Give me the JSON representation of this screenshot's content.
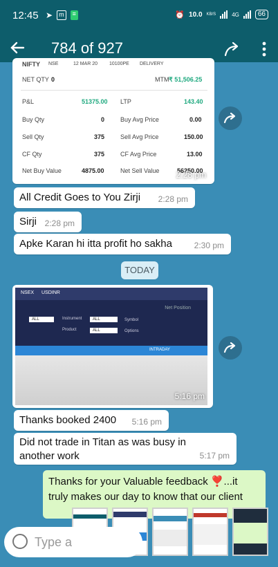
{
  "status": {
    "time": "12:45",
    "speed": "10.0",
    "speed_unit": "KB/S",
    "network": "4G",
    "battery": "66"
  },
  "app_bar": {
    "title": "784 of 927"
  },
  "trade_card": {
    "symbol": "NIFTY",
    "exchange": "NSE",
    "expiry": "12 MAR 20",
    "strike": "10100PE",
    "type": "DELIVERY",
    "net_qty_label": "NET QTY",
    "net_qty": "0",
    "mtm_label": "MTM",
    "mtm": "₹ 51,506.25",
    "pl_label": "P&L",
    "pl": "51375.00",
    "ltp_label": "LTP",
    "ltp": "143.40",
    "buy_qty_label": "Buy Qty",
    "buy_qty": "0",
    "buy_avg_label": "Buy Avg Price",
    "buy_avg": "0.00",
    "sell_qty_label": "Sell Qty",
    "sell_qty": "375",
    "sell_avg_label": "Sell Avg Price",
    "sell_avg": "150.00",
    "cf_qty_label": "CF Qty",
    "cf_qty": "375",
    "cf_avg_label": "CF Avg Price",
    "cf_avg": "13.00",
    "net_buy_label": "Net Buy Value",
    "net_buy": "4875.00",
    "net_sell_label": "Net Sell Value",
    "net_sell": "56250.00",
    "time": "2:28 pm"
  },
  "messages": [
    {
      "text": "All Credit Goes to You Zirji",
      "time": "2:28 pm"
    },
    {
      "text": "Sirji",
      "time": "2:28 pm"
    },
    {
      "text": "Apke Karan hi itta profit ho sakha",
      "time": "2:30 pm"
    }
  ],
  "date_chip": "TODAY",
  "image_msg": {
    "time": "5:16 pm",
    "tab1": "NSEX",
    "tab2": "USDINR",
    "net_position": "Net Position",
    "f_instrument": "Instrument",
    "f_symbol": "Symbol",
    "f_product": "Product",
    "f_options": "Options",
    "opt_all": "ALL",
    "row_text": "INTRADAY"
  },
  "messages2": [
    {
      "text": "Thanks booked 2400",
      "time": "5:16 pm"
    },
    {
      "text": "Did not trade in Titan as was busy in another work",
      "time": "5:17 pm"
    }
  ],
  "outgoing": {
    "text": "Thanks for your Valuable feedback ❣️...it truly makes our day to know that our client"
  },
  "input": {
    "placeholder": "Type a"
  },
  "colors": {
    "header": "#0d5d6b",
    "chat_bg": "#3a8db6",
    "outgoing_bg": "#dcf8c6",
    "profit_green": "#1fa97f"
  }
}
